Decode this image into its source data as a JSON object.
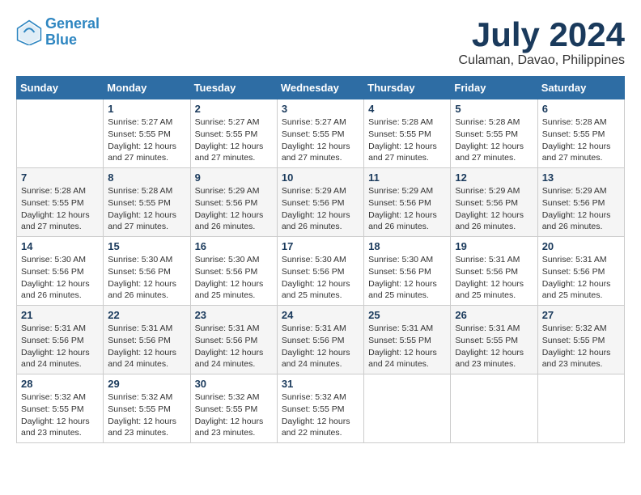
{
  "header": {
    "logo_line1": "General",
    "logo_line2": "Blue",
    "month_year": "July 2024",
    "location": "Culaman, Davao, Philippines"
  },
  "weekdays": [
    "Sunday",
    "Monday",
    "Tuesday",
    "Wednesday",
    "Thursday",
    "Friday",
    "Saturday"
  ],
  "weeks": [
    [
      {
        "day": "",
        "info": ""
      },
      {
        "day": "1",
        "info": "Sunrise: 5:27 AM\nSunset: 5:55 PM\nDaylight: 12 hours\nand 27 minutes."
      },
      {
        "day": "2",
        "info": "Sunrise: 5:27 AM\nSunset: 5:55 PM\nDaylight: 12 hours\nand 27 minutes."
      },
      {
        "day": "3",
        "info": "Sunrise: 5:27 AM\nSunset: 5:55 PM\nDaylight: 12 hours\nand 27 minutes."
      },
      {
        "day": "4",
        "info": "Sunrise: 5:28 AM\nSunset: 5:55 PM\nDaylight: 12 hours\nand 27 minutes."
      },
      {
        "day": "5",
        "info": "Sunrise: 5:28 AM\nSunset: 5:55 PM\nDaylight: 12 hours\nand 27 minutes."
      },
      {
        "day": "6",
        "info": "Sunrise: 5:28 AM\nSunset: 5:55 PM\nDaylight: 12 hours\nand 27 minutes."
      }
    ],
    [
      {
        "day": "7",
        "info": "Sunrise: 5:28 AM\nSunset: 5:55 PM\nDaylight: 12 hours\nand 27 minutes."
      },
      {
        "day": "8",
        "info": "Sunrise: 5:28 AM\nSunset: 5:55 PM\nDaylight: 12 hours\nand 27 minutes."
      },
      {
        "day": "9",
        "info": "Sunrise: 5:29 AM\nSunset: 5:56 PM\nDaylight: 12 hours\nand 26 minutes."
      },
      {
        "day": "10",
        "info": "Sunrise: 5:29 AM\nSunset: 5:56 PM\nDaylight: 12 hours\nand 26 minutes."
      },
      {
        "day": "11",
        "info": "Sunrise: 5:29 AM\nSunset: 5:56 PM\nDaylight: 12 hours\nand 26 minutes."
      },
      {
        "day": "12",
        "info": "Sunrise: 5:29 AM\nSunset: 5:56 PM\nDaylight: 12 hours\nand 26 minutes."
      },
      {
        "day": "13",
        "info": "Sunrise: 5:29 AM\nSunset: 5:56 PM\nDaylight: 12 hours\nand 26 minutes."
      }
    ],
    [
      {
        "day": "14",
        "info": "Sunrise: 5:30 AM\nSunset: 5:56 PM\nDaylight: 12 hours\nand 26 minutes."
      },
      {
        "day": "15",
        "info": "Sunrise: 5:30 AM\nSunset: 5:56 PM\nDaylight: 12 hours\nand 26 minutes."
      },
      {
        "day": "16",
        "info": "Sunrise: 5:30 AM\nSunset: 5:56 PM\nDaylight: 12 hours\nand 25 minutes."
      },
      {
        "day": "17",
        "info": "Sunrise: 5:30 AM\nSunset: 5:56 PM\nDaylight: 12 hours\nand 25 minutes."
      },
      {
        "day": "18",
        "info": "Sunrise: 5:30 AM\nSunset: 5:56 PM\nDaylight: 12 hours\nand 25 minutes."
      },
      {
        "day": "19",
        "info": "Sunrise: 5:31 AM\nSunset: 5:56 PM\nDaylight: 12 hours\nand 25 minutes."
      },
      {
        "day": "20",
        "info": "Sunrise: 5:31 AM\nSunset: 5:56 PM\nDaylight: 12 hours\nand 25 minutes."
      }
    ],
    [
      {
        "day": "21",
        "info": "Sunrise: 5:31 AM\nSunset: 5:56 PM\nDaylight: 12 hours\nand 24 minutes."
      },
      {
        "day": "22",
        "info": "Sunrise: 5:31 AM\nSunset: 5:56 PM\nDaylight: 12 hours\nand 24 minutes."
      },
      {
        "day": "23",
        "info": "Sunrise: 5:31 AM\nSunset: 5:56 PM\nDaylight: 12 hours\nand 24 minutes."
      },
      {
        "day": "24",
        "info": "Sunrise: 5:31 AM\nSunset: 5:56 PM\nDaylight: 12 hours\nand 24 minutes."
      },
      {
        "day": "25",
        "info": "Sunrise: 5:31 AM\nSunset: 5:55 PM\nDaylight: 12 hours\nand 24 minutes."
      },
      {
        "day": "26",
        "info": "Sunrise: 5:31 AM\nSunset: 5:55 PM\nDaylight: 12 hours\nand 23 minutes."
      },
      {
        "day": "27",
        "info": "Sunrise: 5:32 AM\nSunset: 5:55 PM\nDaylight: 12 hours\nand 23 minutes."
      }
    ],
    [
      {
        "day": "28",
        "info": "Sunrise: 5:32 AM\nSunset: 5:55 PM\nDaylight: 12 hours\nand 23 minutes."
      },
      {
        "day": "29",
        "info": "Sunrise: 5:32 AM\nSunset: 5:55 PM\nDaylight: 12 hours\nand 23 minutes."
      },
      {
        "day": "30",
        "info": "Sunrise: 5:32 AM\nSunset: 5:55 PM\nDaylight: 12 hours\nand 23 minutes."
      },
      {
        "day": "31",
        "info": "Sunrise: 5:32 AM\nSunset: 5:55 PM\nDaylight: 12 hours\nand 22 minutes."
      },
      {
        "day": "",
        "info": ""
      },
      {
        "day": "",
        "info": ""
      },
      {
        "day": "",
        "info": ""
      }
    ]
  ]
}
